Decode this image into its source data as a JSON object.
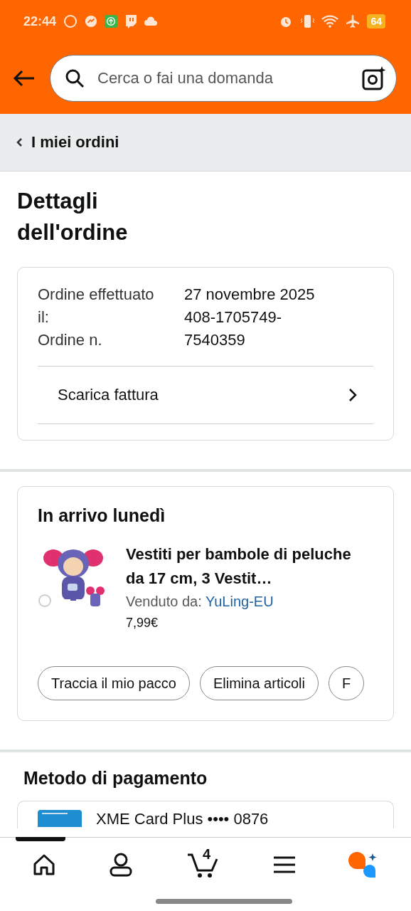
{
  "status_bar": {
    "time": "22:44",
    "battery": "64"
  },
  "search": {
    "placeholder": "Cerca o fai una domanda"
  },
  "breadcrumb": {
    "label": "I miei ordini"
  },
  "page_title": "Dettagli dell'ordine",
  "order_info": {
    "labels": [
      "Ordine effettuato il:",
      "Ordine n."
    ],
    "values": [
      "27 novembre 2025",
      "408-1705749-7540359"
    ],
    "link": "Scarica fattura"
  },
  "delivery": {
    "heading": "In arrivo lunedì",
    "item": {
      "kind": "picture",
      "title": "Vestiti per bambole di peluche da 17 cm, 3 Vestit…",
      "seller_label": "Venduto da:",
      "seller": "YuLing-EU",
      "price": "7,99€"
    },
    "actions": [
      "Traccia il mio pacco",
      "Elimina articoli",
      "F"
    ]
  },
  "payment": {
    "heading": "Metodo di pagamento",
    "card": "XME Card Plus •••• 0876"
  },
  "bottom_nav": {
    "cart_count": "4"
  }
}
